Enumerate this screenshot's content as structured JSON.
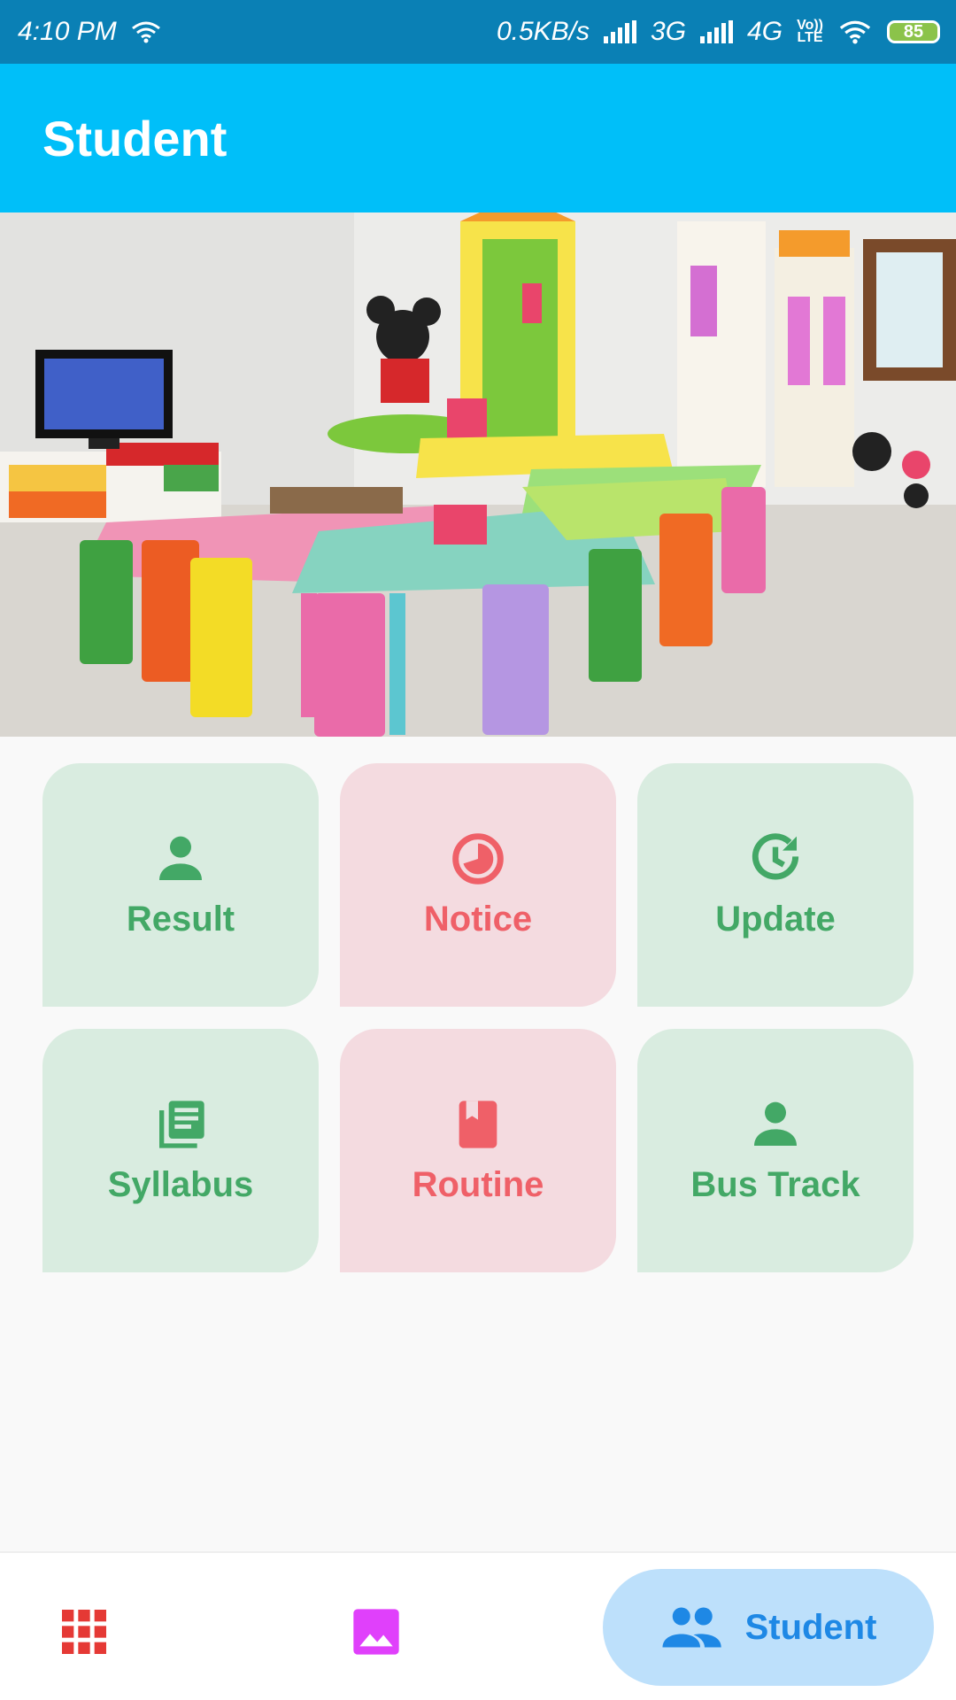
{
  "status_bar": {
    "time": "4:10 PM",
    "network_speed": "0.5KB/s",
    "network_1": "3G",
    "network_2": "4G",
    "volte_top": "Vo))",
    "volte_bottom": "LTE",
    "battery": "85"
  },
  "app_bar": {
    "title": "Student"
  },
  "hero": {
    "description_icon": "classroom-photo"
  },
  "tiles": [
    {
      "label": "Result",
      "icon": "person-icon",
      "color": "#43a866",
      "bg": "#d9ece0"
    },
    {
      "label": "Notice",
      "icon": "pie-clock-icon",
      "color": "#ef6068",
      "bg": "#f4dbe0"
    },
    {
      "label": "Update",
      "icon": "update-icon",
      "color": "#43a866",
      "bg": "#d9ece0"
    },
    {
      "label": "Syllabus",
      "icon": "library-books-icon",
      "color": "#43a866",
      "bg": "#d9ece0"
    },
    {
      "label": "Routine",
      "icon": "book-icon",
      "color": "#ef6068",
      "bg": "#f4dbe0"
    },
    {
      "label": "Bus Track",
      "icon": "person-icon",
      "color": "#43a866",
      "bg": "#d9ece0"
    }
  ],
  "bottom_nav": {
    "apps_icon": "apps-grid-icon",
    "gallery_icon": "image-icon",
    "student_label": "Student",
    "student_icon": "people-icon",
    "active": "Student",
    "apps_color": "#e53935",
    "gallery_color": "#e040fb",
    "student_color": "#1e88e5"
  },
  "colors": {
    "status_bar": "#0a80b5",
    "app_bar": "#00bff9",
    "background": "#f9f9f9"
  }
}
